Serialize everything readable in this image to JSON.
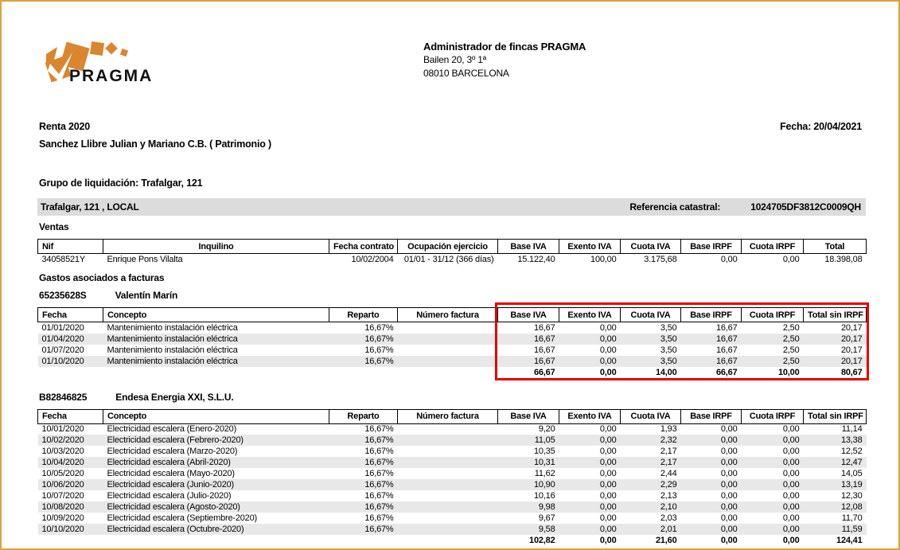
{
  "colors": {
    "page_border": "#E0A13E",
    "logo_orange": "#D9862F",
    "bar_bg": "#DCDCDC",
    "stripe": "#E8E8E8",
    "highlight_red": "#E60000"
  },
  "logo": {
    "text": "PRAGMA"
  },
  "office": {
    "name": "Administrador de fincas PRAGMA",
    "address1": "Bailen 20, 3º 1ª",
    "address2": "08010 BARCELONA"
  },
  "report": {
    "title": "Renta 2020",
    "date": "Fecha: 20/04/2021",
    "owner": "Sanchez Llibre Julian y Mariano C.B. ( Patrimonio )",
    "group": "Grupo de liquidación: Trafalgar, 121"
  },
  "property": {
    "name": "Trafalgar, 121 , LOCAL",
    "ref_label": "Referencia catastral:",
    "ref_value": "1024705DF3812C0009QH"
  },
  "ventas": {
    "title": "Ventas",
    "headers": [
      "Nif",
      "Inquilino",
      "Fecha contrato",
      "Ocupación ejercicio",
      "Base IVA",
      "Exento IVA",
      "Cuota IVA",
      "Base IRPF",
      "Cuota IRPF",
      "Total"
    ],
    "rows": [
      [
        "34058521Y",
        "Enrique Pons Vilalta",
        "10/02/2004",
        "01/01 - 31/12 (366 días)",
        "15.122,40",
        "100,00",
        "3.175,68",
        "0,00",
        "0,00",
        "18.398,08"
      ]
    ]
  },
  "gastos": {
    "title": "Gastos asociados a facturas",
    "headers": [
      "Fecha",
      "Concepto",
      "Reparto",
      "Número factura",
      "Base IVA",
      "Exento IVA",
      "Cuota IVA",
      "Base IRPF",
      "Cuota IRPF",
      "Total sin IRPF"
    ],
    "providers": [
      {
        "nif": "65235628S",
        "name": "Valentín Marín",
        "highlighted": true,
        "rows": [
          [
            "01/01/2020",
            "Mantenimiento instalación eléctrica",
            "16,67%",
            "",
            "16,67",
            "0,00",
            "3,50",
            "16,67",
            "2,50",
            "20,17"
          ],
          [
            "01/04/2020",
            "Mantenimiento instalación eléctrica",
            "16,67%",
            "",
            "16,67",
            "0,00",
            "3,50",
            "16,67",
            "2,50",
            "20,17"
          ],
          [
            "01/07/2020",
            "Mantenimiento instalación eléctrica",
            "16,67%",
            "",
            "16,67",
            "0,00",
            "3,50",
            "16,67",
            "2,50",
            "20,17"
          ],
          [
            "01/10/2020",
            "Mantenimiento instalación eléctrica",
            "16,67%",
            "",
            "16,67",
            "0,00",
            "3,50",
            "16,67",
            "2,50",
            "20,17"
          ]
        ],
        "totals": [
          "66,67",
          "0,00",
          "14,00",
          "66,67",
          "10,00",
          "80,67"
        ]
      },
      {
        "nif": "B82846825",
        "name": "Endesa Energia XXI, S.L.U.",
        "highlighted": false,
        "rows": [
          [
            "10/01/2020",
            "Electricidad escalera (Enero-2020)",
            "16,67%",
            "",
            "9,20",
            "0,00",
            "1,93",
            "0,00",
            "0,00",
            "11,14"
          ],
          [
            "10/02/2020",
            "Electricidad escalera (Febrero-2020)",
            "16,67%",
            "",
            "11,05",
            "0,00",
            "2,32",
            "0,00",
            "0,00",
            "13,38"
          ],
          [
            "10/03/2020",
            "Electricidad escalera (Marzo-2020)",
            "16,67%",
            "",
            "10,35",
            "0,00",
            "2,17",
            "0,00",
            "0,00",
            "12,52"
          ],
          [
            "10/04/2020",
            "Electricidad escalera (Abril-2020)",
            "16,67%",
            "",
            "10,31",
            "0,00",
            "2,17",
            "0,00",
            "0,00",
            "12,47"
          ],
          [
            "10/05/2020",
            "Electricidad escalera (Mayo-2020)",
            "16,67%",
            "",
            "11,62",
            "0,00",
            "2,44",
            "0,00",
            "0,00",
            "14,05"
          ],
          [
            "10/06/2020",
            "Electricidad escalera (Junio-2020)",
            "16,67%",
            "",
            "10,90",
            "0,00",
            "2,29",
            "0,00",
            "0,00",
            "13,19"
          ],
          [
            "10/07/2020",
            "Electricidad escalera (Julio-2020)",
            "16,67%",
            "",
            "10,16",
            "0,00",
            "2,13",
            "0,00",
            "0,00",
            "12,30"
          ],
          [
            "10/08/2020",
            "Electricidad escalera (Agosto-2020)",
            "16,67%",
            "",
            "9,98",
            "0,00",
            "2,10",
            "0,00",
            "0,00",
            "12,08"
          ],
          [
            "10/09/2020",
            "Electricidad escalera (Septiembre-2020)",
            "16,67%",
            "",
            "9,67",
            "0,00",
            "2,03",
            "0,00",
            "0,00",
            "11,70"
          ],
          [
            "10/10/2020",
            "Electricidad escalera (Octubre-2020)",
            "16,67%",
            "",
            "9,58",
            "0,00",
            "2,01",
            "0,00",
            "0,00",
            "11,59"
          ]
        ],
        "totals": [
          "102,82",
          "0,00",
          "21,60",
          "0,00",
          "0,00",
          "124,41"
        ]
      }
    ]
  }
}
